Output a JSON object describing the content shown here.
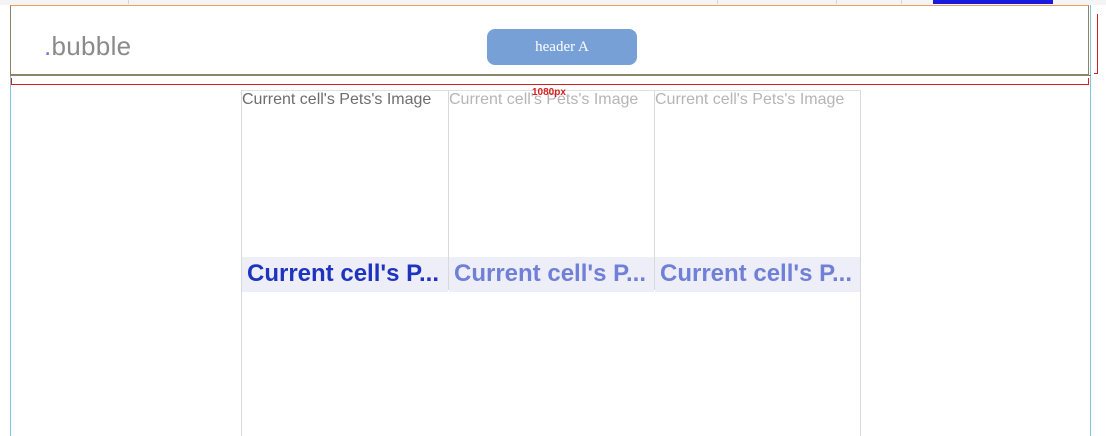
{
  "logo": {
    "dot": ".",
    "text": "bubble"
  },
  "header": {
    "button_label": "header A"
  },
  "guide": {
    "width_label": "1080px"
  },
  "colors": {
    "accent": "#1a1adf",
    "header_button": "#76a0d6",
    "guide": "#d62020",
    "cell_title_primary": "#1f34bd",
    "cell_title_secondary": "#6f80d6"
  },
  "repeating_group": {
    "cells": [
      {
        "image_label": "Current cell's Pets's Image",
        "title": "Current cell's P..."
      },
      {
        "image_label": "Current cell's Pets's Image",
        "title": "Current cell's P..."
      },
      {
        "image_label": "Current cell's Pets's Image",
        "title": "Current cell's P..."
      }
    ]
  }
}
